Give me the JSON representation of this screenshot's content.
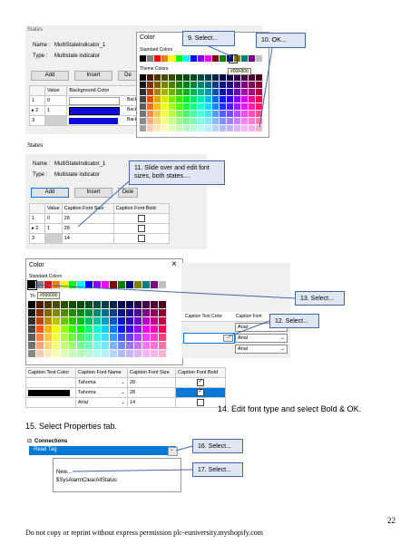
{
  "section1": {
    "panel_title": "States",
    "name_label": "Name :",
    "name_value": "MultiStateIndicator_1",
    "type_label": "Type :",
    "type_value": "Multistate indicator",
    "buttons": [
      "Add",
      "Insert",
      "De"
    ],
    "columns": [
      "Value",
      "Background Color"
    ],
    "rows": [
      {
        "index": "1",
        "value": "0",
        "color": "#ffffff",
        "tail": "Back"
      },
      {
        "index": "2",
        "value": "1",
        "color": "#0b0bd9",
        "tail": "Back"
      },
      {
        "index": "3",
        "value": "",
        "color": "#0b0bd9",
        "tail": "Back"
      }
    ],
    "row_marker": "▸",
    "color_dialog": {
      "title": "Color",
      "standard_label": "Standard Colors",
      "theme_label": "Theme Colors",
      "tooltip": "#00F800"
    },
    "callout_select": "9. Select...",
    "callout_ok": "10. OK..."
  },
  "section2": {
    "panel_title": "States",
    "name_label": "Name :",
    "name_value": "MultiStateIndicator_1",
    "type_label": "Type :",
    "type_value": "Multistate indicator",
    "buttons": [
      "Add",
      "Insert",
      "Dele"
    ],
    "columns": [
      "Value",
      "Caption Font Size",
      "Caption Font Bold"
    ],
    "rows": [
      {
        "index": "1",
        "value": "0",
        "size": "28"
      },
      {
        "index": "2",
        "value": "1",
        "size": "28"
      },
      {
        "index": "3",
        "value": "",
        "size": "14"
      }
    ],
    "callout": "11. Slide over and edit font sizes, both states...."
  },
  "section3": {
    "dialog_title": "Color",
    "close_glyph": "×",
    "standard_label": "Standard Colors",
    "tooltip_prefix": "Th",
    "tooltip": "#000000",
    "grid_columns": [
      "Caption Text Color",
      "Caption Font"
    ],
    "font_options": [
      "Arial",
      "Arial",
      "Arial"
    ],
    "dropdown_glyph": "⌄",
    "callout_13": "13. Select...",
    "callout_12": "12. Select..."
  },
  "section4": {
    "columns": [
      "Caption Text Color",
      "Caption Font Name",
      "Caption Font Size",
      "Caption Font Bold"
    ],
    "rows": [
      {
        "font": "Tahoma",
        "size": "28"
      },
      {
        "font": "Tahoma",
        "size": "28"
      },
      {
        "font": "Arial",
        "size": "14"
      }
    ],
    "step14": "14. Edit font type and select Bold & OK.",
    "step15": "15. Select Properties tab."
  },
  "section5": {
    "group_label": "Connections",
    "expander": "⊟",
    "selected_item": "Read Tag",
    "menu_new": "New...",
    "menu_item": "$SysAlarmClearAllStatus",
    "callout_16": "16. Select...",
    "callout_17": "17. Select..."
  },
  "footer": {
    "page_number": "22",
    "notice": "Do not copy or reprint without express permission plc-euniversity.myshopify.com"
  }
}
